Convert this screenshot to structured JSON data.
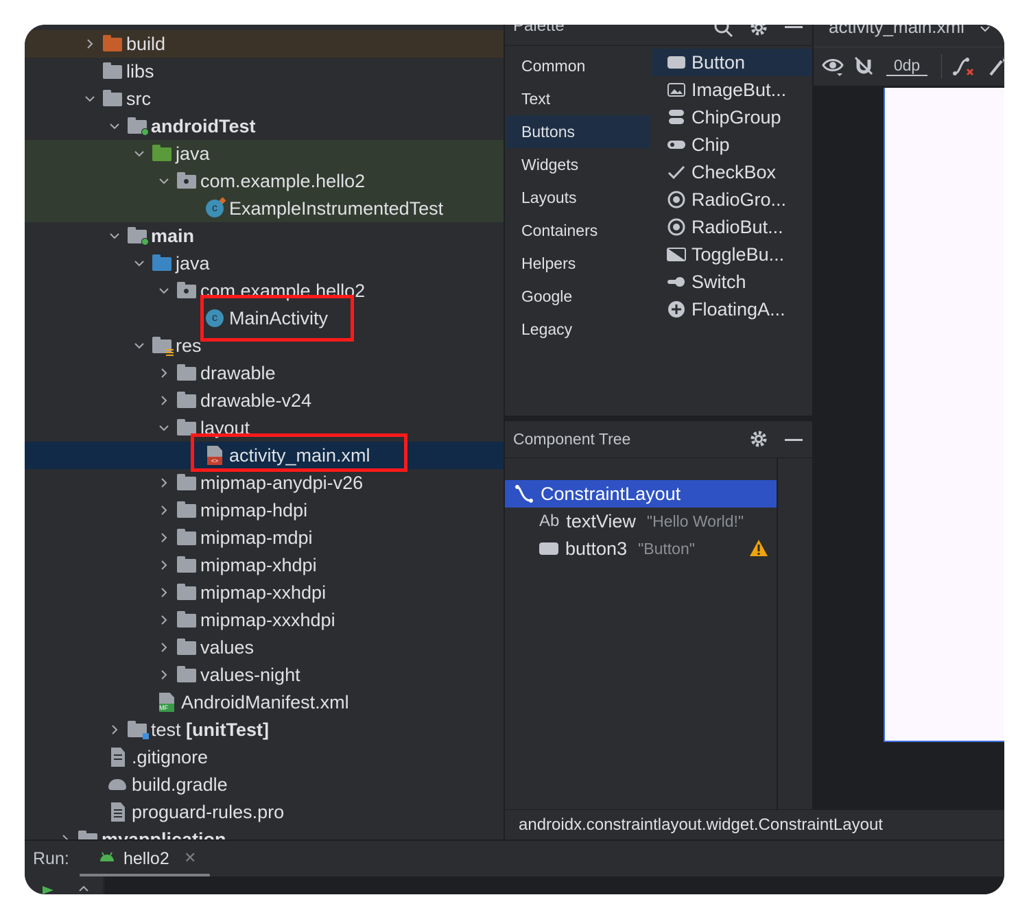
{
  "project_tree": {
    "items": [
      {
        "label": "build"
      },
      {
        "label": "libs"
      },
      {
        "label": "src"
      },
      {
        "label": "androidTest"
      },
      {
        "label": "java"
      },
      {
        "label": "com.example.hello2"
      },
      {
        "label": "ExampleInstrumentedTest"
      },
      {
        "label": "main"
      },
      {
        "label": "java"
      },
      {
        "label": "com.example.hello2"
      },
      {
        "label": "MainActivity"
      },
      {
        "label": "res"
      },
      {
        "label": "drawable"
      },
      {
        "label": "drawable-v24"
      },
      {
        "label": "layout"
      },
      {
        "label": "activity_main.xml"
      },
      {
        "label": "mipmap-anydpi-v26"
      },
      {
        "label": "mipmap-hdpi"
      },
      {
        "label": "mipmap-mdpi"
      },
      {
        "label": "mipmap-xhdpi"
      },
      {
        "label": "mipmap-xxhdpi"
      },
      {
        "label": "mipmap-xxxhdpi"
      },
      {
        "label": "values"
      },
      {
        "label": "values-night"
      },
      {
        "label": "AndroidManifest.xml"
      },
      {
        "label": "test",
        "suffix": "[unitTest]"
      },
      {
        "label": ".gitignore"
      },
      {
        "label": "build.gradle"
      },
      {
        "label": "proguard-rules.pro"
      },
      {
        "label": "myapplication"
      }
    ]
  },
  "palette": {
    "title": "Palette",
    "categories": [
      "Common",
      "Text",
      "Buttons",
      "Widgets",
      "Layouts",
      "Containers",
      "Helpers",
      "Google",
      "Legacy"
    ],
    "selected_category": "Buttons",
    "widgets": [
      "Button",
      "ImageBut...",
      "ChipGroup",
      "Chip",
      "CheckBox",
      "RadioGro...",
      "RadioBut...",
      "ToggleBu...",
      "Switch",
      "FloatingA..."
    ]
  },
  "component_tree": {
    "title": "Component Tree",
    "root": "ConstraintLayout",
    "children": [
      {
        "id": "textView",
        "text": "\"Hello World!\"",
        "prefix": "Ab"
      },
      {
        "id": "button3",
        "text": "\"Button\"",
        "warning": true
      }
    ]
  },
  "design": {
    "tab_title": "activity_main.xml",
    "margin_value": "0dp"
  },
  "status_bar": {
    "text": "androidx.constraintlayout.widget.ConstraintLayout"
  },
  "run_bar": {
    "label": "Run:",
    "config": "hello2"
  },
  "colors": {
    "highlight_box": "#ff1a1a",
    "selection": "#2e52c4",
    "warning": "#f0a30a"
  }
}
